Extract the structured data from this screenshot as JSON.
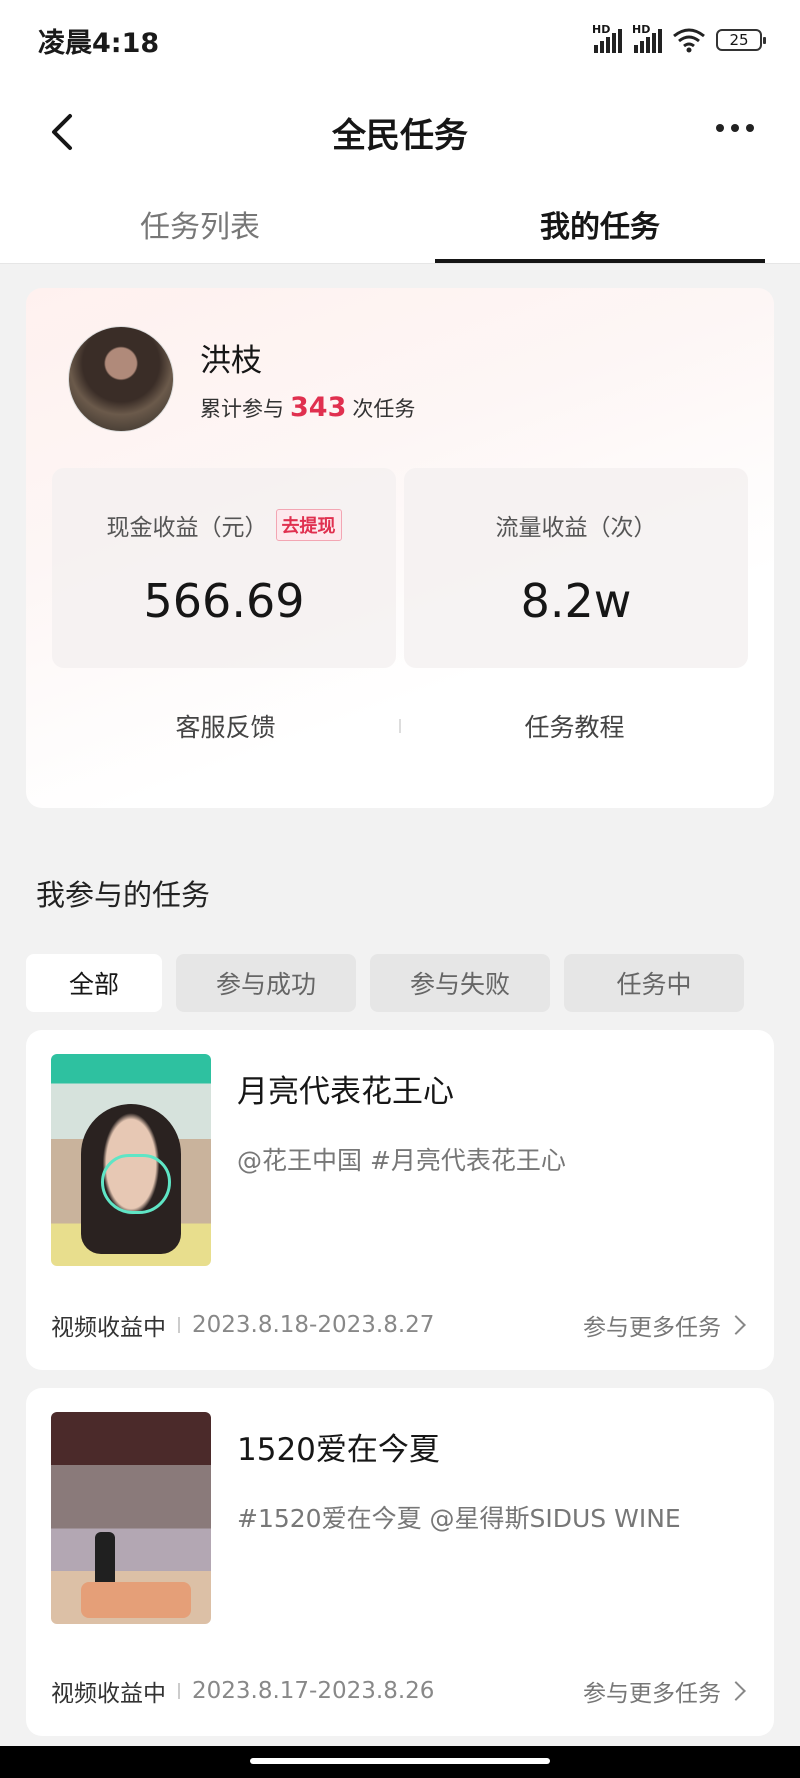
{
  "status_bar": {
    "time": "凌晨4:18",
    "signal_label": "HD",
    "battery": "25"
  },
  "header": {
    "title": "全民任务"
  },
  "tabs": [
    {
      "label": "任务列表",
      "active": false
    },
    {
      "label": "我的任务",
      "active": true
    }
  ],
  "profile": {
    "name": "洪枝",
    "participation_prefix": "累计参与",
    "participation_count": "343",
    "participation_suffix": "次任务"
  },
  "earnings": {
    "cash_label": "现金收益（元）",
    "withdraw_label": "去提现",
    "cash_value": "566.69",
    "traffic_label": "流量收益（次）",
    "traffic_value": "8.2w"
  },
  "links": {
    "service": "客服反馈",
    "tutorial": "任务教程"
  },
  "section": {
    "title": "我参与的任务"
  },
  "filters": [
    "全部",
    "参与成功",
    "参与失败",
    "任务中"
  ],
  "tasks": [
    {
      "title": "月亮代表花王心",
      "tags": "@花王中国 #月亮代表花王心",
      "status": "视频收益中",
      "date": "2023.8.18-2023.8.27",
      "more": "参与更多任务"
    },
    {
      "title": "1520爱在今夏",
      "tags": "#1520爱在今夏 @星得斯SIDUS WINE",
      "status": "视频收益中",
      "date": "2023.8.17-2023.8.26",
      "more": "参与更多任务"
    }
  ],
  "colors": {
    "accent": "#e0304f",
    "background": "#f2f2f2"
  }
}
